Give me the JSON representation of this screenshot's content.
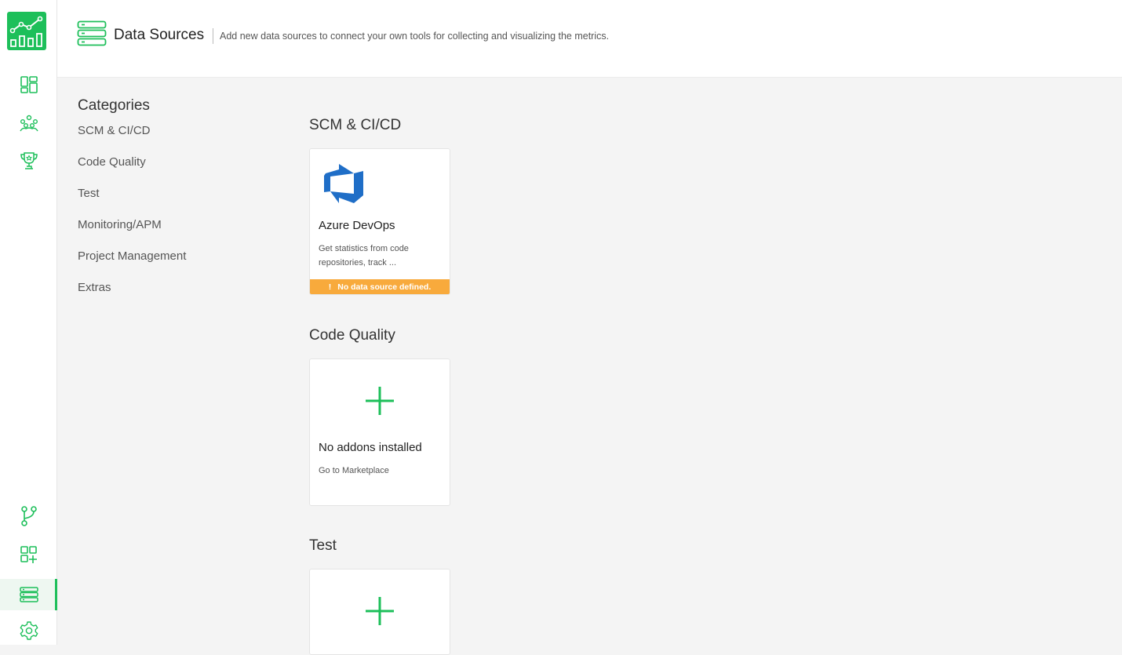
{
  "header": {
    "title": "Data Sources",
    "description": "Add new data sources to connect your own tools for collecting and visualizing the metrics."
  },
  "sidebar": {
    "top_items": [
      "dashboards-icon",
      "teams-icon",
      "trophy-icon"
    ],
    "bottom_items": [
      "branch-icon",
      "add-widget-icon",
      "data-sources-icon",
      "settings-icon"
    ],
    "active": "data-sources-icon"
  },
  "categories": {
    "title": "Categories",
    "items": [
      "SCM & CI/CD",
      "Code Quality",
      "Test",
      "Monitoring/APM",
      "Project Management",
      "Extras"
    ]
  },
  "sections": [
    {
      "title": "SCM & CI/CD",
      "card": {
        "name": "Azure DevOps",
        "description": "Get statistics from code repositories, track ...",
        "warning": "No data source defined.",
        "warning_mark": "!"
      }
    },
    {
      "title": "Code Quality",
      "card": {
        "name": "No addons installed",
        "description": "Go to Marketplace"
      }
    },
    {
      "title": "Test"
    }
  ],
  "colors": {
    "accent": "#1dbf5a",
    "warning": "#f8aa3c",
    "azure_blue": "#1f6ec7"
  }
}
